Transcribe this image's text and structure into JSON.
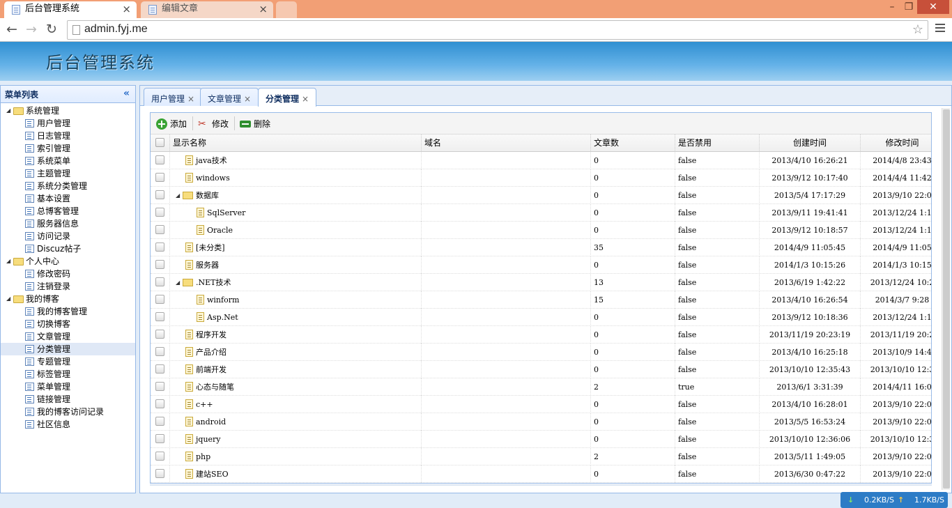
{
  "browser": {
    "tabs": [
      {
        "title": "后台管理系统",
        "active": true
      },
      {
        "title": "编辑文章",
        "active": false
      }
    ],
    "url": "admin.fyj.me",
    "minimize": "–",
    "restore": "❐",
    "close": "✕",
    "back": "←",
    "forward": "→",
    "reload": "↻",
    "star": "☆",
    "tab_close": "×"
  },
  "app": {
    "title": "后台管理系统"
  },
  "sidebar": {
    "header": "菜单列表",
    "collapse": "«",
    "groups": [
      {
        "label": "系统管理",
        "items": [
          "用户管理",
          "日志管理",
          "索引管理",
          "系统菜单",
          "主题管理",
          "系统分类管理",
          "基本设置",
          "总博客管理",
          "服务器信息",
          "访问记录",
          "Discuz帖子"
        ]
      },
      {
        "label": "个人中心",
        "items": [
          "修改密码",
          "注销登录"
        ]
      },
      {
        "label": "我的博客",
        "items": [
          "我的博客管理",
          "切换博客",
          "文章管理",
          "分类管理",
          "专题管理",
          "标签管理",
          "菜单管理",
          "链接管理",
          "我的博客访问记录",
          "社区信息"
        ]
      }
    ],
    "selected": "分类管理"
  },
  "main_tabs": [
    {
      "label": "用户管理",
      "close": "×",
      "active": false
    },
    {
      "label": "文章管理",
      "close": "×",
      "active": false
    },
    {
      "label": "分类管理",
      "close": "×",
      "active": true
    }
  ],
  "toolbar": {
    "add": "添加",
    "edit": "修改",
    "delete": "删除"
  },
  "grid": {
    "columns": [
      "显示名称",
      "域名",
      "文章数",
      "是否禁用",
      "创建时间",
      "修改时间"
    ],
    "rows": [
      {
        "name": "java技术",
        "level": 0,
        "folder": false,
        "domain": "",
        "count": "0",
        "disabled": "false",
        "created": "2013/4/10 16:26:21",
        "modified": "2014/4/8 23:43"
      },
      {
        "name": "windows",
        "level": 0,
        "folder": false,
        "domain": "",
        "count": "0",
        "disabled": "false",
        "created": "2013/9/12 10:17:40",
        "modified": "2014/4/4 11:42"
      },
      {
        "name": "数据库",
        "level": 0,
        "folder": true,
        "domain": "",
        "count": "0",
        "disabled": "false",
        "created": "2013/5/4 17:17:29",
        "modified": "2013/9/10 22:0"
      },
      {
        "name": "SqlServer",
        "level": 1,
        "folder": false,
        "domain": "",
        "count": "0",
        "disabled": "false",
        "created": "2013/9/11 19:41:41",
        "modified": "2013/12/24 1:1"
      },
      {
        "name": "Oracle",
        "level": 1,
        "folder": false,
        "domain": "",
        "count": "0",
        "disabled": "false",
        "created": "2013/9/12 10:18:57",
        "modified": "2013/12/24 1:1"
      },
      {
        "name": "[未分类]",
        "level": 0,
        "folder": false,
        "domain": "",
        "count": "35",
        "disabled": "false",
        "created": "2014/4/9 11:05:45",
        "modified": "2014/4/9 11:05"
      },
      {
        "name": "服务器",
        "level": 0,
        "folder": false,
        "domain": "",
        "count": "0",
        "disabled": "false",
        "created": "2014/1/3 10:15:26",
        "modified": "2014/1/3 10:15"
      },
      {
        "name": ".NET技术",
        "level": 0,
        "folder": true,
        "domain": "",
        "count": "13",
        "disabled": "false",
        "created": "2013/6/19 1:42:22",
        "modified": "2013/12/24 10:2"
      },
      {
        "name": "winform",
        "level": 1,
        "folder": false,
        "domain": "",
        "count": "15",
        "disabled": "false",
        "created": "2013/4/10 16:26:54",
        "modified": "2014/3/7 9:28"
      },
      {
        "name": "Asp.Net",
        "level": 1,
        "folder": false,
        "domain": "",
        "count": "0",
        "disabled": "false",
        "created": "2013/9/12 10:18:36",
        "modified": "2013/12/24 1:1"
      },
      {
        "name": "程序开发",
        "level": 0,
        "folder": false,
        "domain": "",
        "count": "0",
        "disabled": "false",
        "created": "2013/11/19 20:23:19",
        "modified": "2013/11/19 20:2"
      },
      {
        "name": "产品介绍",
        "level": 0,
        "folder": false,
        "domain": "",
        "count": "0",
        "disabled": "false",
        "created": "2013/4/10 16:25:18",
        "modified": "2013/10/9 14:4"
      },
      {
        "name": "前端开发",
        "level": 0,
        "folder": false,
        "domain": "",
        "count": "0",
        "disabled": "false",
        "created": "2013/10/10 12:35:43",
        "modified": "2013/10/10 12:3"
      },
      {
        "name": "心态与随笔",
        "level": 0,
        "folder": false,
        "domain": "",
        "count": "2",
        "disabled": "true",
        "created": "2013/6/1 3:31:39",
        "modified": "2014/4/11 16:0"
      },
      {
        "name": "c++",
        "level": 0,
        "folder": false,
        "domain": "",
        "count": "0",
        "disabled": "false",
        "created": "2013/4/10 16:28:01",
        "modified": "2013/9/10 22:0"
      },
      {
        "name": "android",
        "level": 0,
        "folder": false,
        "domain": "",
        "count": "0",
        "disabled": "false",
        "created": "2013/5/5 16:53:24",
        "modified": "2013/9/10 22:0"
      },
      {
        "name": "jquery",
        "level": 0,
        "folder": false,
        "domain": "",
        "count": "0",
        "disabled": "false",
        "created": "2013/10/10 12:36:06",
        "modified": "2013/10/10 12:3"
      },
      {
        "name": "php",
        "level": 0,
        "folder": false,
        "domain": "",
        "count": "2",
        "disabled": "false",
        "created": "2013/5/11 1:49:05",
        "modified": "2013/9/10 22:0"
      },
      {
        "name": "建站SEO",
        "level": 0,
        "folder": false,
        "domain": "",
        "count": "0",
        "disabled": "false",
        "created": "2013/6/30 0:47:22",
        "modified": "2013/9/10 22:0"
      }
    ]
  },
  "status": {
    "down": "0.2KB/S",
    "up": "1.7KB/S",
    "down_arrow": "↓",
    "up_arrow": "↑"
  },
  "colors": {
    "chrome_frame": "#f29f75",
    "banner": "#2f8fd1",
    "panel_border": "#95b8e7",
    "selected_row": "#dfe8f6"
  }
}
